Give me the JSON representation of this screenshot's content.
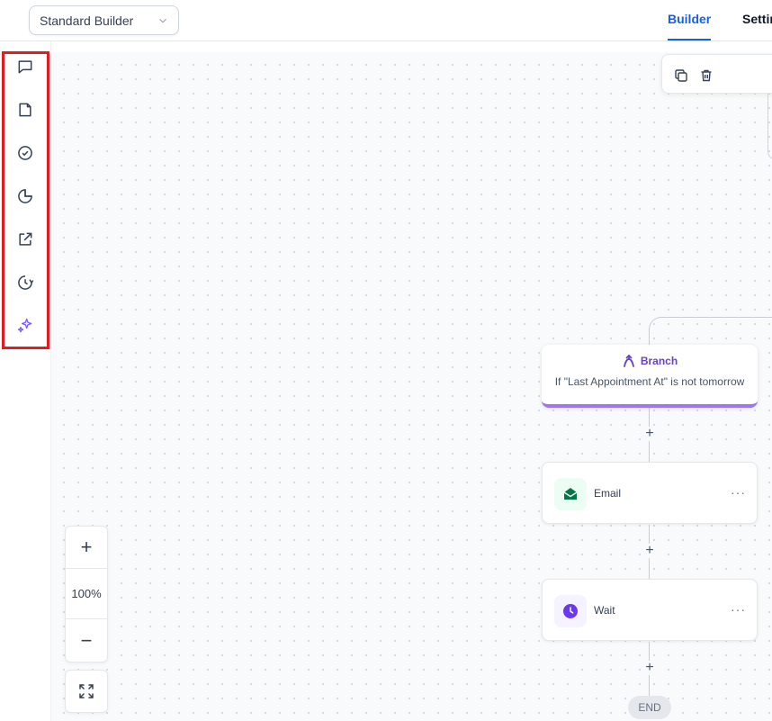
{
  "header": {
    "builder_select": {
      "value": "Standard Builder"
    },
    "tabs": [
      {
        "label": "Builder",
        "active": true
      },
      {
        "label": "Settin",
        "active": false
      }
    ]
  },
  "sidebar": {
    "items": [
      {
        "icon": "chat-icon"
      },
      {
        "icon": "document-icon"
      },
      {
        "icon": "check-circle-icon"
      },
      {
        "icon": "pie-chart-icon"
      },
      {
        "icon": "external-link-icon"
      },
      {
        "icon": "history-icon"
      },
      {
        "icon": "ai-sparkle-icon"
      }
    ],
    "highlight_color": "#e31b23"
  },
  "canvas": {
    "toolbar": {
      "icons": [
        "copy-icon",
        "trash-icon"
      ]
    },
    "branch_node": {
      "title": "Branch",
      "condition": "If \"Last Appointment At\" is not tomorrow",
      "accent": "#9e77ed"
    },
    "actions": [
      {
        "label": "Email",
        "icon": "email-icon",
        "icon_bg": "#ecfdf3",
        "icon_color": "#067647",
        "more": "···"
      },
      {
        "label": "Wait",
        "icon": "clock-icon",
        "icon_bg": "#f4f3ff",
        "icon_color": "#6938ef",
        "more": "···"
      }
    ],
    "add_step_symbol": "+",
    "end_label": "END"
  },
  "zoom": {
    "zoom_in": "+",
    "level": "100%",
    "zoom_out": "−"
  },
  "colors": {
    "accent": "#155eef",
    "branch_purple": "#6941c6"
  }
}
